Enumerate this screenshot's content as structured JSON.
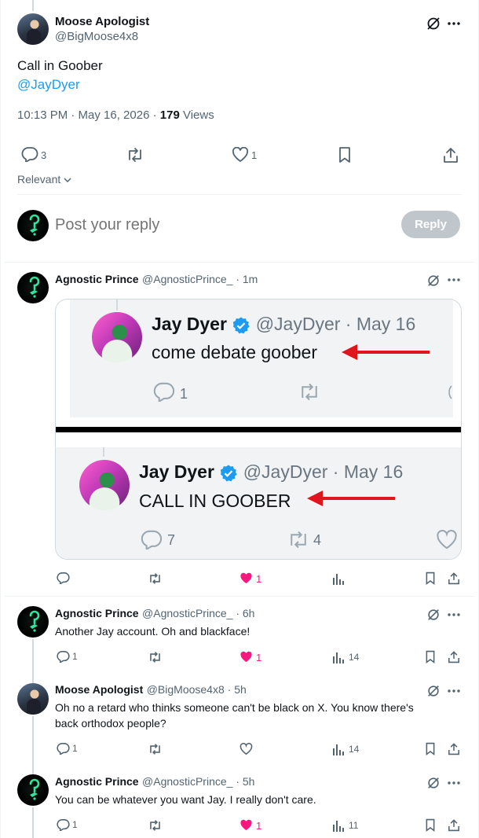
{
  "main_post": {
    "author_name": "Moose Apologist",
    "author_handle": "@BigMoose4x8",
    "text": "Call in Goober",
    "mention": "@JayDyer",
    "time": "10:13 PM · May 16, 2026 · ",
    "views_count": "179",
    "views_label": " Views",
    "replies": "3",
    "likes": "1",
    "sort_label": "Relevant"
  },
  "composer": {
    "placeholder": "Post your reply",
    "button": "Reply"
  },
  "replies": [
    {
      "name": "Agnostic Prince",
      "handle": "@AgnosticPrince_ · 1m",
      "text": "",
      "replies": "",
      "likes": "1",
      "views": ""
    },
    {
      "name": "Agnostic Prince",
      "handle": "@AgnosticPrince_ · 6h",
      "text": "Another Jay account. Oh and blackface!",
      "replies": "1",
      "likes": "1",
      "views": "14"
    },
    {
      "name": "Moose Apologist",
      "handle": "@BigMoose4x8 · 5h",
      "text_line1": "Oh no a retard who thinks someone can't be black on X. You know there's",
      "text_line2": "back orthodox people?",
      "replies": "1",
      "likes": "",
      "views": "14"
    },
    {
      "name": "Agnostic Prince",
      "handle": "@AgnosticPrince_ · 5h",
      "text": "You can be whatever you want Jay. I really don't care.",
      "replies": "1",
      "likes": "1",
      "views": "11"
    }
  ],
  "embedded_image": {
    "top": {
      "name": "Jay Dyer",
      "handle": "@JayDyer · May 16",
      "text": "come debate goober",
      "replies": "1"
    },
    "bottom": {
      "name": "Jay Dyer",
      "handle": "@JayDyer · May 16",
      "text": "CALL IN GOOBER",
      "replies": "7",
      "retweets": "4"
    }
  },
  "colors": {
    "accent": "#1d9bf0",
    "like_pink": "#f91880",
    "muted": "#536471",
    "arrow_red": "#e0161e",
    "reply_disabled": "#c0c7cc"
  },
  "icons": [
    "grok-icon",
    "more-icon",
    "reply-icon",
    "retweet-icon",
    "heart-icon",
    "bookmark-icon",
    "share-icon",
    "views-icon",
    "chevron-down-icon",
    "verified-icon"
  ]
}
